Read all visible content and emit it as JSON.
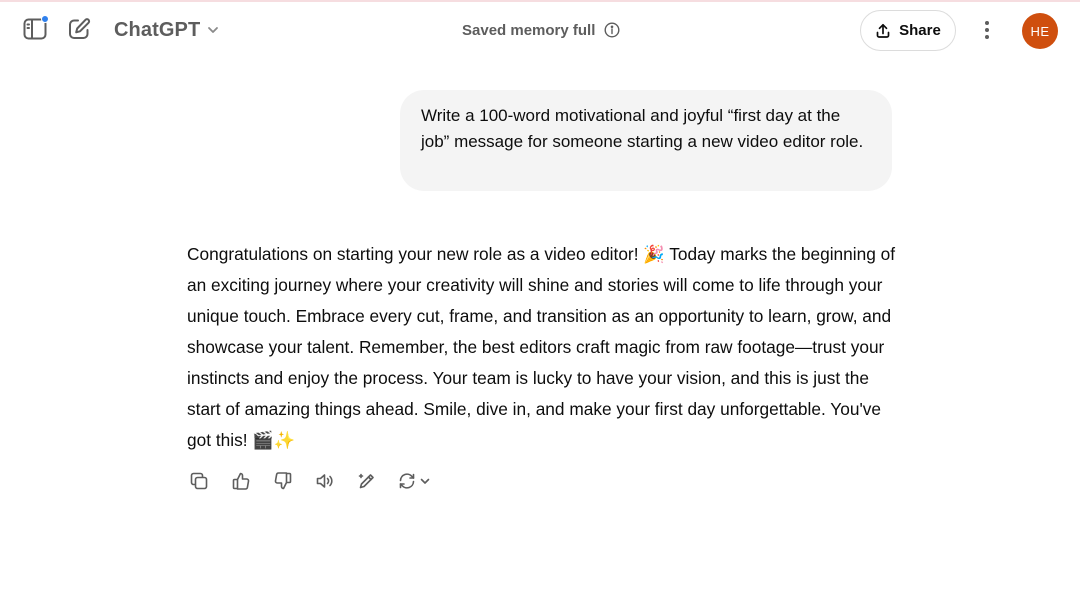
{
  "header": {
    "model_name": "ChatGPT",
    "memory_status": "Saved memory full",
    "share_label": "Share",
    "avatar_initials": "HE",
    "avatar_color": "#cf4f0e",
    "notification_dot_color": "#2f80ed"
  },
  "conversation": {
    "user_message": "Write a 100-word motivational and joyful “first day at the job” message for someone starting a new video editor role.",
    "assistant_message": "Congratulations on starting your new role as a video editor! 🎉 Today marks the beginning of an exciting journey where your creativity will shine and stories will come to life through your unique touch. Embrace every cut, frame, and transition as an opportunity to learn, grow, and showcase your talent. Remember, the best editors craft magic from raw footage—trust your instincts and enjoy the process. Your team is lucky to have your vision, and this is just the start of amazing things ahead. Smile, dive in, and make your first day unforgettable. You've got this! 🎬✨"
  },
  "message_actions": [
    "copy-icon",
    "thumbs-up-icon",
    "thumbs-down-icon",
    "read-aloud-icon",
    "edit-canvas-icon",
    "regenerate-icon"
  ]
}
